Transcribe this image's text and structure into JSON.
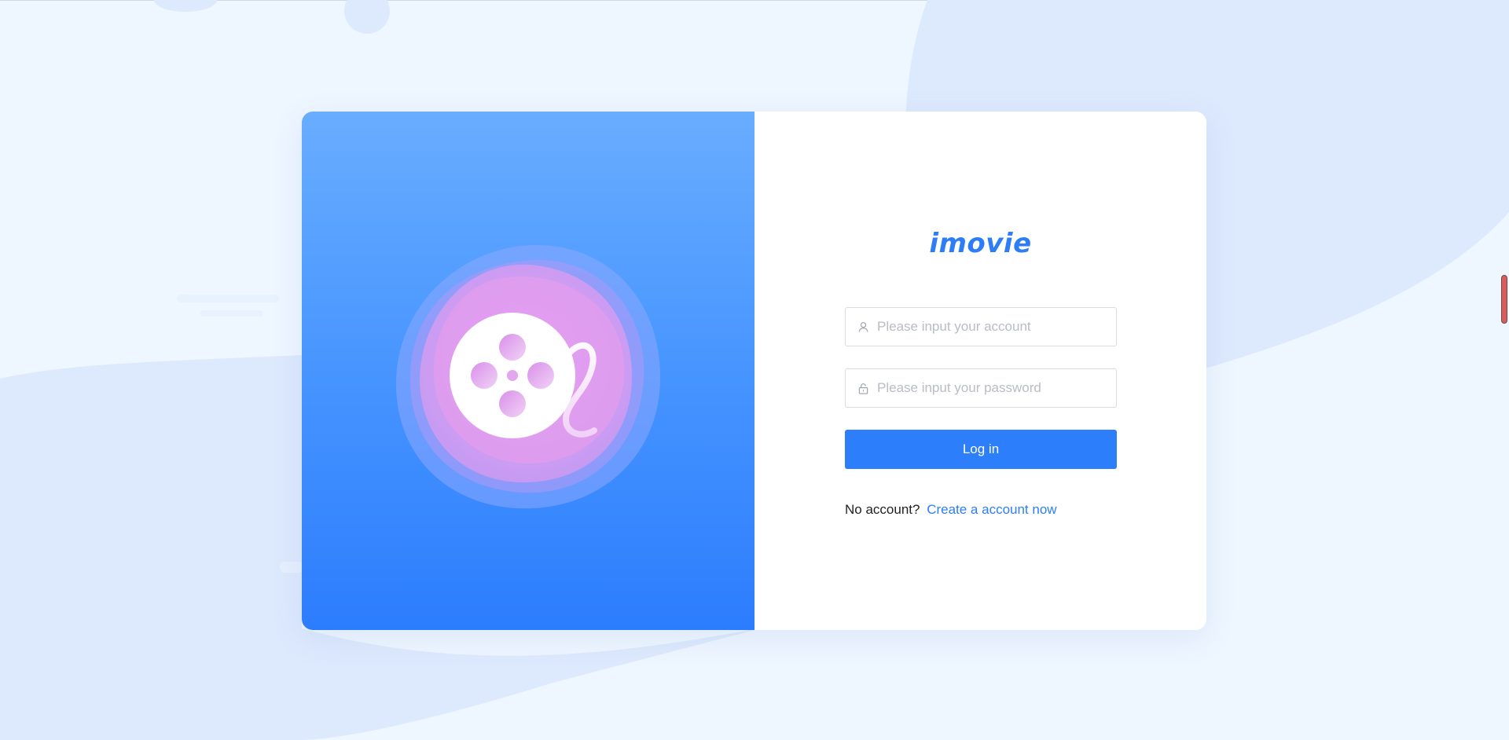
{
  "app": {
    "logo_text": "imovie"
  },
  "login_form": {
    "account_placeholder": "Please input your account",
    "password_placeholder": "Please input your password",
    "account_value": "",
    "password_value": "",
    "login_label": "Log in",
    "no_account_text": "No account?",
    "signup_link_label": "Create a account now"
  },
  "icons": {
    "account": "user-icon",
    "password": "lock-icon",
    "illustration": "film-reel-icon"
  },
  "colors": {
    "accent": "#2c7efa",
    "page_background": "#eef6ff",
    "panel_gradient_top": "#69adff",
    "panel_gradient_bottom": "#2c7dfe",
    "blob_pink": "#e19cf0",
    "scroll_indicator": "#e15a5a"
  }
}
